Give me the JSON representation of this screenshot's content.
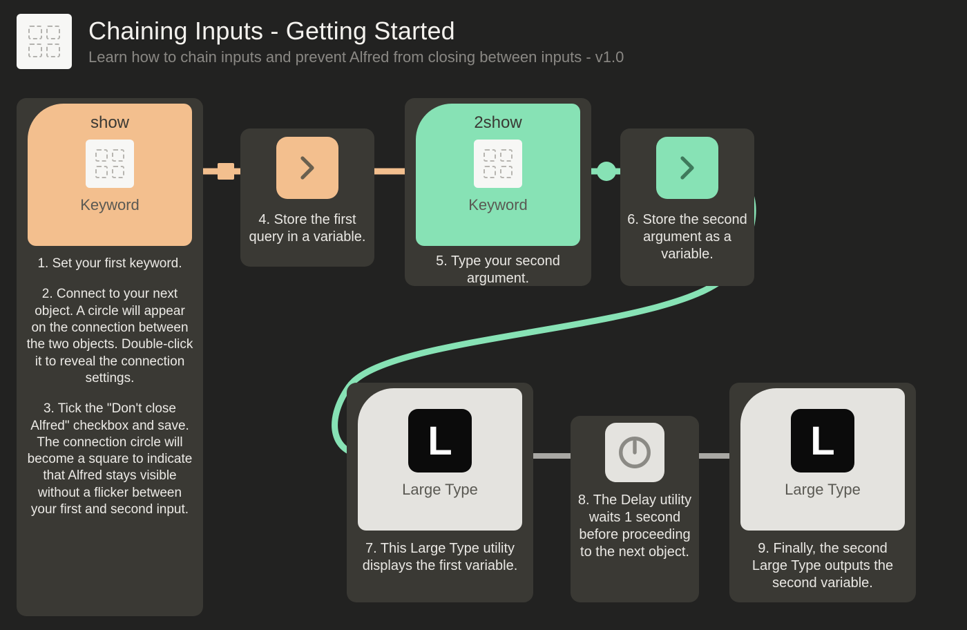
{
  "header": {
    "title": "Chaining Inputs - Getting Started",
    "subtitle": "Learn how to chain inputs and prevent Alfred from closing between inputs - v1.0"
  },
  "nodes": {
    "keyword1": {
      "title": "show",
      "type_label": "Keyword"
    },
    "keyword2": {
      "title": "2show",
      "type_label": "Keyword"
    },
    "large1": {
      "type_label": "Large Type"
    },
    "large2": {
      "type_label": "Large Type"
    }
  },
  "captions": {
    "c4": "4. Store the first query in a variable.",
    "c5": "5. Type your second argument.",
    "c6": "6. Store the second argument as a variable.",
    "c7": "7. This Large Type utility displays the first variable.",
    "c8": "8. The Delay utility waits 1 second before proceeding to the next object.",
    "c9": "9. Finally, the second Large Type outputs the second variable."
  },
  "instructions": {
    "p1": "1. Set your first keyword.",
    "p2": "2. Connect to your next object. A circle will appear on the connection between the two objects. Double-click it to reveal the connection settings.",
    "p3": "3. Tick the \"Don't close Alfred\" checkbox and save. The connection circle will become a square to indicate that Alfred stays visible without a flicker between your first and second input."
  },
  "icons": {
    "workflow_icon": "workflow-grid-icon",
    "chevron": "chevron-right-icon",
    "large_type": "large-type-L-icon",
    "delay": "delay-knob-icon"
  },
  "colors": {
    "orange": "#f3bf8e",
    "green": "#87e2b5",
    "grey": "#e4e3df",
    "panel": "#3a3934",
    "bg": "#222221"
  }
}
